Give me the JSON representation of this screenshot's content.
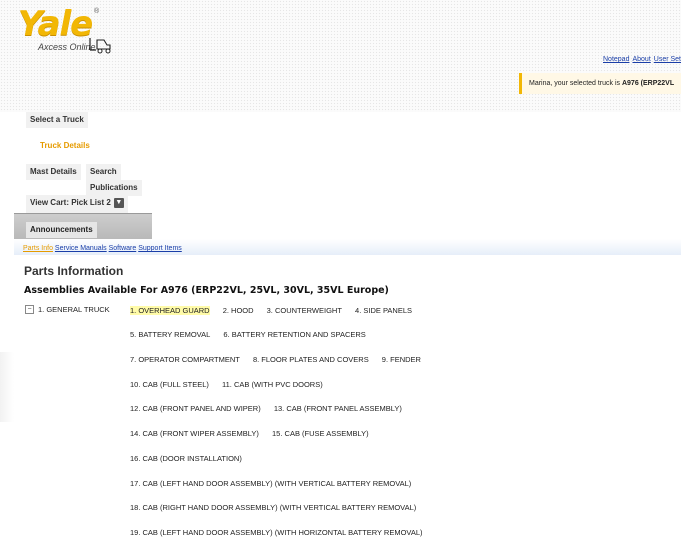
{
  "logo": {
    "word": "Yale",
    "registered": "®",
    "tagline": "Axcess Online",
    "icon": "forklift-icon"
  },
  "top_links": [
    "Notepad",
    "About",
    "User Set"
  ],
  "truck_bar": {
    "prefix": "Marina, your selected truck is ",
    "model": "A976 (ERP22VL"
  },
  "nav": {
    "select_truck": "Select a Truck",
    "truck_details": "Truck Details",
    "mast_details": "Mast Details",
    "search": "Search",
    "publications": "Publications",
    "view_cart": "View Cart: Pick List 2",
    "announcements": "Announcements"
  },
  "tabs": [
    "Parts Info",
    "Service Manuals",
    "Software",
    "Support Items"
  ],
  "page": {
    "title": "Parts Information",
    "subtitle": "Assemblies Available For A976 (ERP22VL, 25VL, 30VL, 35VL Europe)",
    "category": "1. GENERAL TRUCK",
    "toggle": "−"
  },
  "assembly_rows": [
    [
      "1. OVERHEAD GUARD",
      "2. HOOD",
      "3. COUNTERWEIGHT",
      "4. SIDE PANELS"
    ],
    [
      "5. BATTERY REMOVAL",
      "6. BATTERY RETENTION AND SPACERS"
    ],
    [
      "7. OPERATOR COMPARTMENT",
      "8. FLOOR PLATES AND COVERS",
      "9. FENDER"
    ],
    [
      "10. CAB (FULL STEEL)",
      "11. CAB (WITH PVC DOORS)"
    ],
    [
      "12. CAB (FRONT PANEL AND WIPER)",
      "13. CAB (FRONT PANEL ASSEMBLY)"
    ],
    [
      "14. CAB (FRONT WIPER ASSEMBLY)",
      "15. CAB (FUSE ASSEMBLY)"
    ],
    [
      "16. CAB (DOOR INSTALLATION)"
    ],
    [
      "17. CAB (LEFT HAND DOOR ASSEMBLY) (WITH VERTICAL BATTERY REMOVAL)"
    ],
    [
      "18. CAB (RIGHT HAND DOOR ASSEMBLY) (WITH VERTICAL BATTERY REMOVAL)"
    ],
    [
      "19. CAB (LEFT HAND DOOR ASSEMBLY) (WITH HORIZONTAL BATTERY REMOVAL)"
    ]
  ],
  "colors": {
    "brand_yellow": "#f2b705",
    "accent_orange": "#e69b00",
    "link_blue": "#1a3ea8",
    "highlight": "#fffba8"
  }
}
